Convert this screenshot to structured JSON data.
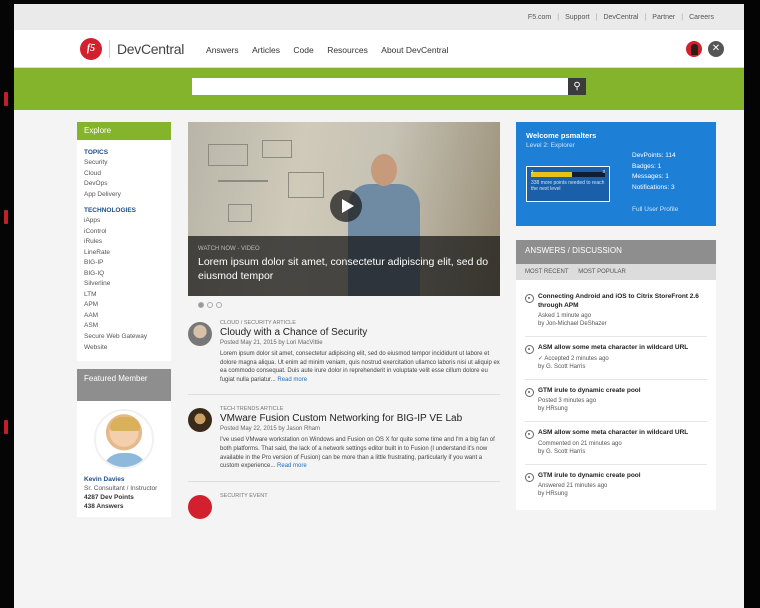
{
  "utility_nav": [
    "F5.com",
    "Support",
    "DevCentral",
    "Partner",
    "Careers"
  ],
  "header": {
    "logo_mark": "f5",
    "logo_text": "DevCentral",
    "nav": [
      "Answers",
      "Articles",
      "Code",
      "Resources",
      "About DevCentral"
    ]
  },
  "search": {
    "placeholder": ""
  },
  "sidebar": {
    "title": "Explore",
    "topics_heading": "TOPICS",
    "topics": [
      "Security",
      "Cloud",
      "DevOps",
      "App Delivery"
    ],
    "tech_heading": "TECHNOLOGIES",
    "technologies": [
      "iApps",
      "iControl",
      "iRules",
      "LineRate",
      "BIG-IP",
      "BIG-IQ",
      "Silverline",
      "LTM",
      "APM",
      "AAM",
      "ASM",
      "Secure Web Gateway",
      "Website"
    ]
  },
  "featured": {
    "title": "Featured Member",
    "name": "Kevin Davies",
    "role": "Sr. Consultant / Instructor",
    "points": "4287 Dev Points",
    "answers": "438 Answers"
  },
  "hero": {
    "kicker": "WATCH NOW - VIDEO",
    "title": "Lorem ipsum dolor sit amet, consectetur adipiscing elit, sed do eiusmod tempor"
  },
  "articles": [
    {
      "kicker": "CLOUD / SECURITY ARTICLE",
      "title": "Cloudy with a Chance of Security",
      "meta": "Posted May 21, 2015 by Lori MacVittie",
      "text": "Lorem ipsum dolor sit amet, consectetur adipiscing elit, sed do eiusmod tempor incididunt ut labore et dolore magna aliqua. Ut enim ad minim veniam, quis nostrud exercitation ullamco laboris nisi ut aliquip ex ea commodo consequat. Duis aute irure dolor in reprehenderit in voluptate velit esse cillum dolore eu fugiat nulla pariatur...",
      "more": "Read more"
    },
    {
      "kicker": "TECH TRENDS ARTICLE",
      "title": "VMware Fusion Custom Networking for BIG-IP VE Lab",
      "meta": "Posted May 22, 2015 by Jason Rham",
      "text": "I've used VMware workstation on Windows and Fusion on OS X for quite some time and I'm a big fan of both platforms. That said, the lack of a network settings editor built in to Fusion (I understand it's now available in the Pro version of Fusion) can be more than a little frustrating, particularly if you want a custom experience...",
      "more": "Read more"
    },
    {
      "kicker": "SECURITY EVENT",
      "title": "",
      "meta": "",
      "text": "",
      "more": ""
    }
  ],
  "welcome": {
    "title": "Welcome psmalters",
    "level": "Level 2: Explorer",
    "bar_start": "2",
    "bar_end": "3",
    "bar_progress": 0.55,
    "bar_text": "338 more points needed to reach the next level",
    "stats": [
      {
        "label": "DevPoints:",
        "value": "114"
      },
      {
        "label": "Badges:",
        "value": "1"
      },
      {
        "label": "Messages:",
        "value": "1"
      },
      {
        "label": "Notifications:",
        "value": "3"
      }
    ],
    "profile_link": "Full User Profile"
  },
  "answers": {
    "title": "ANSWERS / DISCUSSION",
    "tabs": [
      "MOST RECENT",
      "MOST POPULAR"
    ],
    "items": [
      {
        "title": "Connecting Android and iOS to Citrix StoreFront 2.6 through APM",
        "status": "Asked 1 minute ago",
        "by": "by Jon-Michael DeShazer"
      },
      {
        "title": "ASM allow some meta character in wildcard URL",
        "status": "✓ Accepted 2 minutes ago",
        "by": "by G. Scott Harris"
      },
      {
        "title": "GTM irule to dynamic create pool",
        "status": "Posted 3 minutes ago",
        "by": "by HRsung"
      },
      {
        "title": "ASM allow some meta character in wildcard URL",
        "status": "Commented on 21 minutes ago",
        "by": "by G. Scott Harris"
      },
      {
        "title": "GTM irule to dynamic create pool",
        "status": "Answered 21 minutes ago",
        "by": "by HRsung"
      }
    ]
  },
  "colors": {
    "brand_red": "#d3202f",
    "brand_green": "#84b42c",
    "welcome_blue": "#1e7fd6",
    "panel_gray": "#8e8e8e"
  }
}
